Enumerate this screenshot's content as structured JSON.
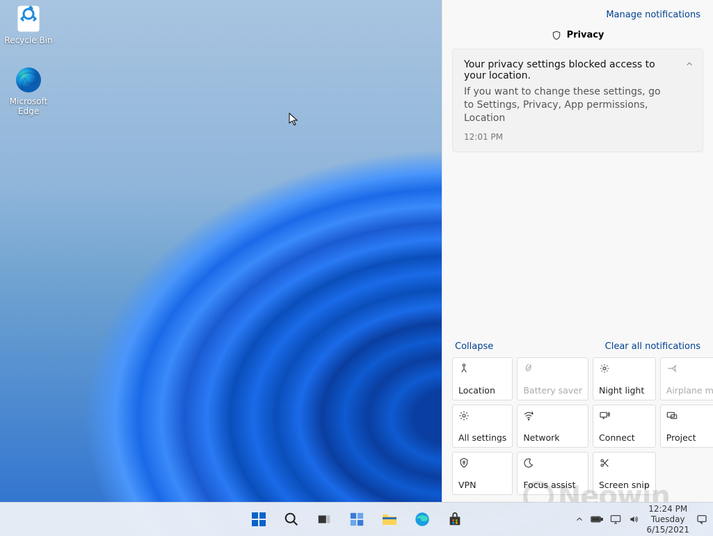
{
  "desktop": {
    "icons": [
      {
        "label": "Recycle Bin"
      },
      {
        "label": "Microsoft Edge"
      }
    ]
  },
  "panel": {
    "manage_label": "Manage notifications",
    "section_title": "Privacy",
    "notification": {
      "title": "Your privacy settings blocked access to your location.",
      "body": "If you want to change these settings, go to Settings, Privacy, App permissions, Location",
      "time": "12:01 PM"
    },
    "collapse_label": "Collapse",
    "clear_label": "Clear all notifications",
    "tiles": [
      {
        "label": "Location",
        "disabled": false
      },
      {
        "label": "Battery saver",
        "disabled": true
      },
      {
        "label": "Night light",
        "disabled": false
      },
      {
        "label": "Airplane mode",
        "disabled": true
      },
      {
        "label": "All settings",
        "disabled": false
      },
      {
        "label": "Network",
        "disabled": false
      },
      {
        "label": "Connect",
        "disabled": false
      },
      {
        "label": "Project",
        "disabled": false
      },
      {
        "label": "VPN",
        "disabled": false
      },
      {
        "label": "Focus assist",
        "disabled": false
      },
      {
        "label": "Screen snip",
        "disabled": false
      }
    ]
  },
  "taskbar": {
    "time": "12:24 PM",
    "day": "Tuesday",
    "date": "6/15/2021"
  },
  "watermark": "Neowin"
}
